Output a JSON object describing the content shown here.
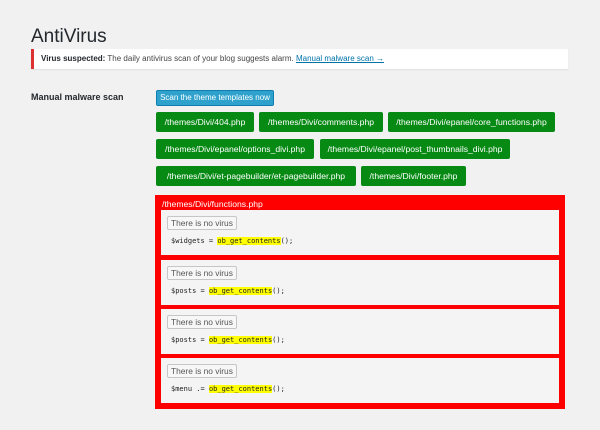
{
  "page": {
    "title": "AntiVirus"
  },
  "notice": {
    "strong": "Virus suspected:",
    "text": "The daily antivirus scan of your blog suggests alarm.",
    "link": "Manual malware scan →",
    "accent_color": "#dc3232"
  },
  "manual_scan": {
    "label": "Manual malware scan",
    "button_label": "Scan the theme templates now",
    "files": [
      "/themes/Divi/404.php",
      "/themes/Divi/comments.php",
      "/themes/Divi/epanel/core_functions.php",
      "/themes/Divi/epanel/options_divi.php",
      "/themes/Divi/epanel/post_thumbnails_divi.php",
      "/themes/Divi/et-pagebuilder/et-pagebuilder.php",
      "/themes/Divi/footer.php"
    ],
    "file_button_color": "#078a14"
  },
  "infected": {
    "file": "/themes/Divi/functions.php",
    "color": "#ff0000",
    "results": [
      {
        "button": "There is no virus",
        "code_before": "$widgets = ",
        "code_highlight": "ob_get_contents",
        "code_after": "();"
      },
      {
        "button": "There is no virus",
        "code_before": "$posts = ",
        "code_highlight": "ob_get_contents",
        "code_after": "();"
      },
      {
        "button": "There is no virus",
        "code_before": "$posts = ",
        "code_highlight": "ob_get_contents",
        "code_after": "();"
      },
      {
        "button": "There is no virus",
        "code_before": "$menu .= ",
        "code_highlight": "ob_get_contents",
        "code_after": "();"
      }
    ]
  }
}
